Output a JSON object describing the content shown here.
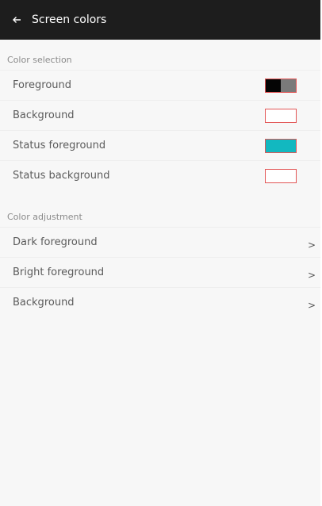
{
  "appbar": {
    "title": "Screen colors",
    "back_icon": "arrow-left-icon"
  },
  "color_selection": {
    "header": "Color selection",
    "items": [
      {
        "label": "Foreground",
        "swatch": [
          "#050505",
          "#7a7a7a"
        ]
      },
      {
        "label": "Background",
        "swatch": [
          "#ffffff"
        ]
      },
      {
        "label": "Status foreground",
        "swatch": [
          "#12b8c0"
        ]
      },
      {
        "label": "Status background",
        "swatch": [
          "#ffffff"
        ]
      }
    ]
  },
  "color_adjustment": {
    "header": "Color adjustment",
    "items": [
      {
        "label": "Dark foreground",
        "chevron": ">"
      },
      {
        "label": "Bright foreground",
        "chevron": ">"
      },
      {
        "label": "Background",
        "chevron": ">"
      }
    ]
  },
  "colors": {
    "appbar_bg": "#1d1d1d",
    "swatch_border": "#e25555"
  }
}
